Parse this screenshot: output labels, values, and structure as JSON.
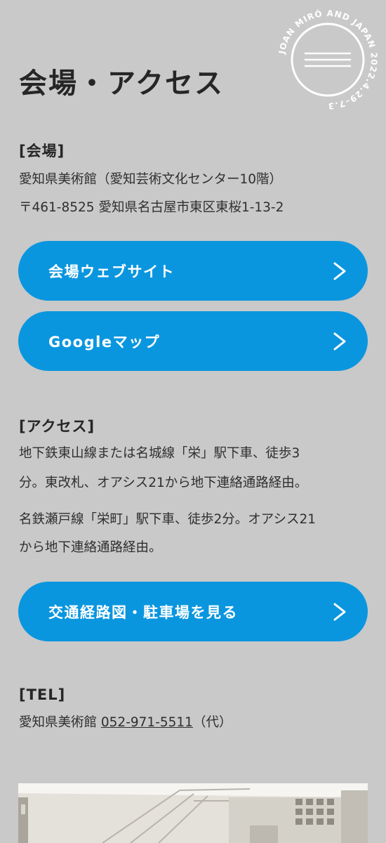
{
  "header": {
    "title": "会場・アクセス",
    "badge_text": "JOAN MIRÓ AND JAPAN 2022.4.29–7.3"
  },
  "venue": {
    "heading": "[会場]",
    "line1": "愛知県美術館（愛知芸術文化センター10階）",
    "line2": "〒461-8525 愛知県名古屋市東区東桜1-13-2",
    "website_button": "会場ウェブサイト",
    "map_button": "Googleマップ"
  },
  "access": {
    "heading": "[アクセス]",
    "para1_line1": "地下鉄東山線または名城線「栄」駅下車、徒歩3",
    "para1_line2": "分。東改札、オアシス21から地下連絡通路経由。",
    "para2_line1": "名鉄瀬戸線「栄町」駅下車、徒歩2分。オアシス21",
    "para2_line2": "から地下連絡通路経由。",
    "route_button": "交通経路図・駐車場を見る"
  },
  "tel": {
    "heading": "[TEL]",
    "label": "愛知県美術館 ",
    "number": "052-971-5511",
    "suffix": "（代）"
  },
  "colors": {
    "background": "#c9c9c9",
    "button": "#0a96df",
    "text": "#2a2a2a"
  },
  "icons": {
    "chevron": "chevron-right-icon"
  }
}
